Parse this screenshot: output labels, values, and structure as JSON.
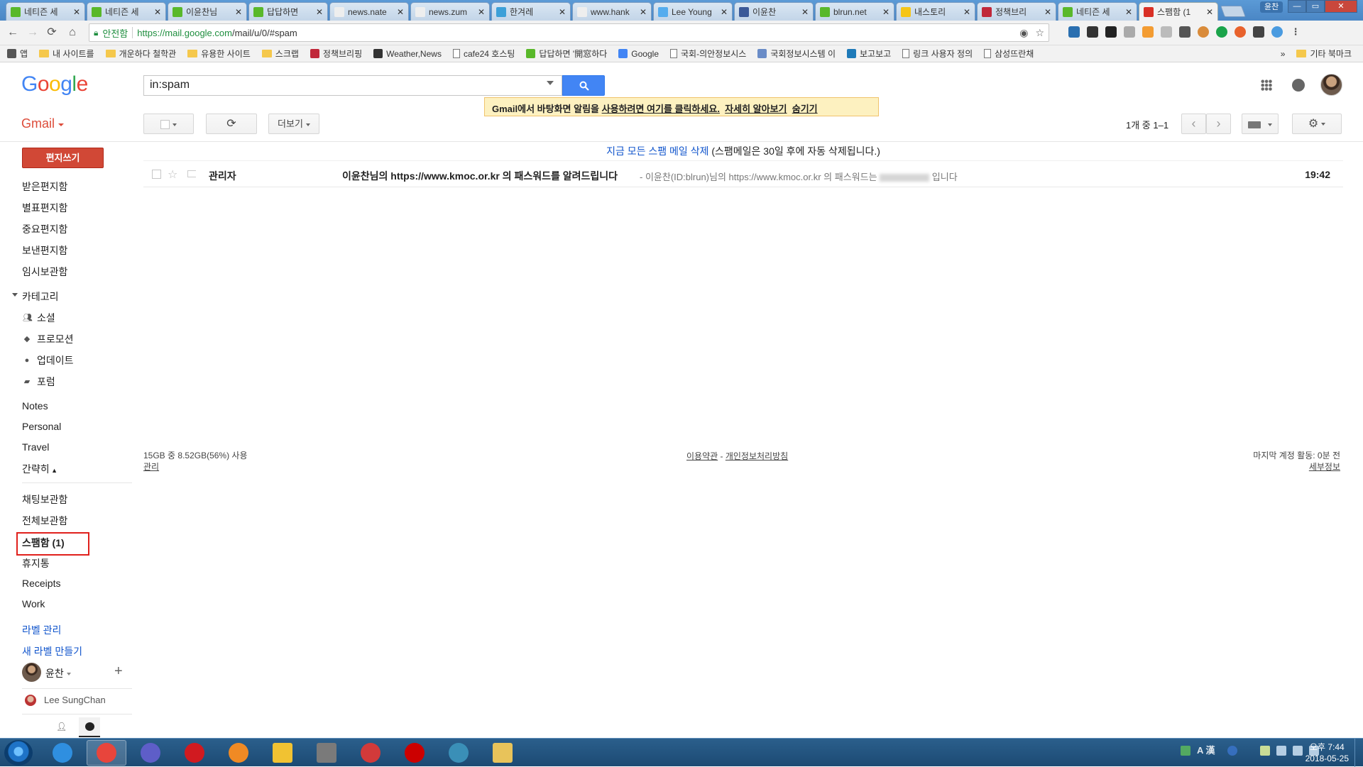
{
  "browser": {
    "tabs": [
      {
        "title": "네티즌 세",
        "color": "#59b82a"
      },
      {
        "title": "네티즌 세",
        "color": "#59b82a"
      },
      {
        "title": "이윤찬님",
        "color": "#59b82a"
      },
      {
        "title": "답답하면",
        "color": "#59b82a"
      },
      {
        "title": "news.nate",
        "color": "#eeeeee"
      },
      {
        "title": "news.zum",
        "color": "#eeeeee"
      },
      {
        "title": "한겨레",
        "color": "#3da0d8"
      },
      {
        "title": "www.hank",
        "color": "#eeeeee"
      },
      {
        "title": "Lee Young",
        "color": "#55acee"
      },
      {
        "title": "이윤찬",
        "color": "#3b5998"
      },
      {
        "title": "blrun.net",
        "color": "#59b82a"
      },
      {
        "title": "내스토리",
        "color": "#f5c518"
      },
      {
        "title": "정책브리",
        "color": "#c0283a"
      },
      {
        "title": "네티즌 세",
        "color": "#59b82a"
      },
      {
        "title": "스팸함 (1",
        "color": "#d93025",
        "active": true
      }
    ],
    "tab_close": "✕",
    "profile_name": "윤찬",
    "window_controls": [
      "—",
      "▭",
      "✕"
    ],
    "secure_label": "안전함",
    "url_host": "https://mail.google.com",
    "url_path": "/mail/u/0/#spam",
    "bookmarks": [
      {
        "label": "앱",
        "icon": "apps-icon"
      },
      {
        "label": "내 사이트를",
        "icon": "folder-icon"
      },
      {
        "label": "개운하다 철학관",
        "icon": "folder-icon"
      },
      {
        "label": "유용한 사이트",
        "icon": "folder-icon"
      },
      {
        "label": "스크랩",
        "icon": "folder-icon"
      },
      {
        "label": "정책브리핑",
        "icon": "policy-icon"
      },
      {
        "label": "Weather,News",
        "icon": "weather-icon"
      },
      {
        "label": "cafe24 호스팅",
        "icon": "page-icon"
      },
      {
        "label": "답답하면 '開窓하다",
        "icon": "sprout-icon"
      },
      {
        "label": "Google",
        "icon": "google-icon"
      },
      {
        "label": "국회-의안정보시스",
        "icon": "page-icon"
      },
      {
        "label": "국회정보시스템 이",
        "icon": "assembly-icon"
      },
      {
        "label": "보고보고",
        "icon": "video-icon"
      },
      {
        "label": "링크 사용자 정의",
        "icon": "page-icon"
      },
      {
        "label": "삼성뜨란채",
        "icon": "page-icon"
      }
    ],
    "bookmarks_more": "»",
    "other_bookmarks": "기타 북마크"
  },
  "gmail": {
    "logo_letters": [
      "G",
      "o",
      "o",
      "g",
      "l",
      "e"
    ],
    "search_value": "in:spam",
    "notification": {
      "text": "Gmail에서 바탕화면 알림을 ",
      "link1": "사용하려면 여기를 클릭하세요.",
      "link2": "자세히 알아보기",
      "link3": "숨기기"
    },
    "app_label": "Gmail",
    "toolbar": {
      "more_label": "더보기",
      "refresh_glyph": "⟳",
      "pager": "1개 중 1–1",
      "prev_glyph": "‹",
      "next_glyph": "›"
    },
    "compose_label": "편지쓰기",
    "nav": {
      "inbox": "받은편지함",
      "starred": "별표편지함",
      "important": "중요편지함",
      "sent": "보낸편지함",
      "drafts": "임시보관함",
      "categories": "카테고리",
      "social": "소셜",
      "promotions": "프로모션",
      "updates": "업데이트",
      "forums": "포럼",
      "notes": "Notes",
      "personal": "Personal",
      "travel": "Travel",
      "less": "간략히",
      "chats": "채팅보관함",
      "all_mail": "전체보관함",
      "spam": "스팸함 (1)",
      "trash": "휴지통",
      "receipts": "Receipts",
      "work": "Work",
      "manage_labels": "라벨 관리",
      "new_label": "새 라벨 만들기"
    },
    "spam_banner": {
      "link": "지금 모든 스팸 메일 삭제",
      "text": " (스팸메일은 30일 후에 자동 삭제됩니다.)"
    },
    "messages": [
      {
        "sender": "관리자",
        "subject": "이윤찬님의 https://www.kmoc.or.kr 의 패스워드를 알려드립니다",
        "snippet_before": " - 이윤찬(ID:blrun)님의 https://www.kmoc.or.kr 의 패스워드는",
        "snippet_after": "입니다",
        "time": "19:42"
      }
    ],
    "footer": {
      "storage": "15GB 중 8.52GB(56%) 사용",
      "manage": "관리",
      "terms": "이용약관",
      "dash": " - ",
      "privacy": "개인정보처리방침",
      "last_activity": "마지막 계정 활동: 0분 전",
      "details": "세부정보"
    },
    "hangouts": {
      "user": "윤찬",
      "plus": "+",
      "contact": "Lee SungChan"
    }
  },
  "taskbar": {
    "apps": [
      {
        "name": "ie-icon",
        "color": "#2f8fe0"
      },
      {
        "name": "chrome-icon",
        "color": "#e8453c",
        "active": true
      },
      {
        "name": "app3-icon",
        "color": "#5e5ec8"
      },
      {
        "name": "opera-icon",
        "color": "#d11a20"
      },
      {
        "name": "firefox-icon",
        "color": "#f08a24"
      },
      {
        "name": "notes-app-icon",
        "color": "#f1c232"
      },
      {
        "name": "book-app-icon",
        "color": "#7a7a7a"
      },
      {
        "name": "pokeball-icon",
        "color": "#d23a3a"
      },
      {
        "name": "record-icon",
        "color": "#cc0000"
      },
      {
        "name": "tree-app-icon",
        "color": "#3a8fb7"
      },
      {
        "name": "explorer-icon",
        "color": "#e8c35a"
      }
    ],
    "ime": "A 漢",
    "clock_time": "오후 7:44",
    "clock_date": "2018-05-25"
  }
}
